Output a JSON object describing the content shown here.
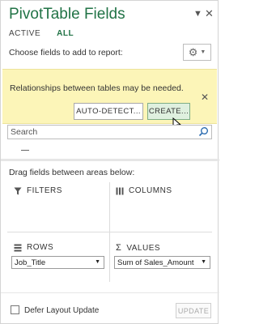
{
  "panel": {
    "title": "PivotTable Fields",
    "header_dropdown_icon": "chevron-down-icon",
    "close_icon": "close-icon"
  },
  "tabs": [
    {
      "label": "ACTIVE",
      "active": false
    },
    {
      "label": "ALL",
      "active": true
    }
  ],
  "choose_label": "Choose fields to add to report:",
  "tools_button": {
    "icon": "gear-icon"
  },
  "notice": {
    "text": "Relationships between tables may be needed.",
    "auto_detect_label": "AUTO-DETECT...",
    "create_label": "CREATE...",
    "background": "#fcf5b8"
  },
  "search": {
    "placeholder": "Search",
    "value": ""
  },
  "drag_label": "Drag fields between areas below:",
  "areas": {
    "filters": {
      "label": "FILTERS",
      "icon": "filter-icon"
    },
    "columns": {
      "label": "COLUMNS",
      "icon": "columns-icon"
    },
    "rows": {
      "label": "ROWS",
      "icon": "rows-icon",
      "field": "Job_Title"
    },
    "values": {
      "label": "VALUES",
      "icon": "sigma-icon",
      "symbol": "Σ",
      "field": "Sum of Sales_Amount"
    }
  },
  "footer": {
    "defer_label": "Defer Layout Update",
    "update_label": "UPDATE",
    "defer_checked": false
  },
  "colors": {
    "accent": "#217346"
  }
}
